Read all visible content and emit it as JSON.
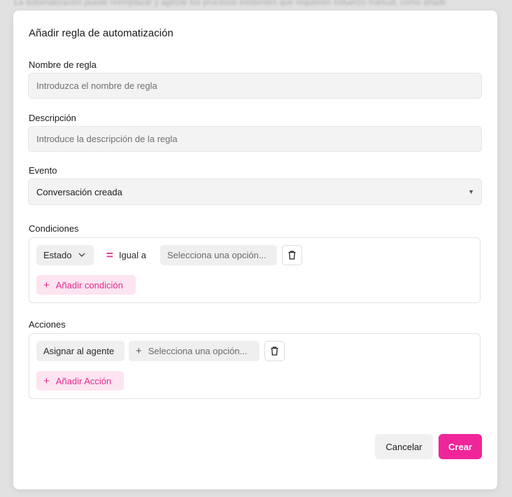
{
  "background_text": "La automatización puede reemplazar y agilizar los procesos existentes que requieren esfuerzo manual, como añadir",
  "modal": {
    "title": "Añadir regla de automatización",
    "rule_name": {
      "label": "Nombre de regla",
      "placeholder": "Introduzca el nombre de regla",
      "value": ""
    },
    "description": {
      "label": "Descripción",
      "placeholder": "Introduce la descripción de la regla",
      "value": ""
    },
    "event": {
      "label": "Evento",
      "selected": "Conversación creada"
    },
    "conditions": {
      "label": "Condiciones",
      "attribute": "Estado",
      "operator": "Igual a",
      "value_placeholder": "Selecciona una opción...",
      "add_label": "Añadir condición"
    },
    "actions": {
      "label": "Acciones",
      "action": "Asignar al agente",
      "value_placeholder": "Selecciona una opción...",
      "add_label": "Añadir Acción"
    },
    "buttons": {
      "cancel": "Cancelar",
      "create": "Crear"
    }
  },
  "colors": {
    "accent": "#f0259a",
    "accent_soft": "#fde4f1",
    "field_bg": "#f3f3f3"
  }
}
